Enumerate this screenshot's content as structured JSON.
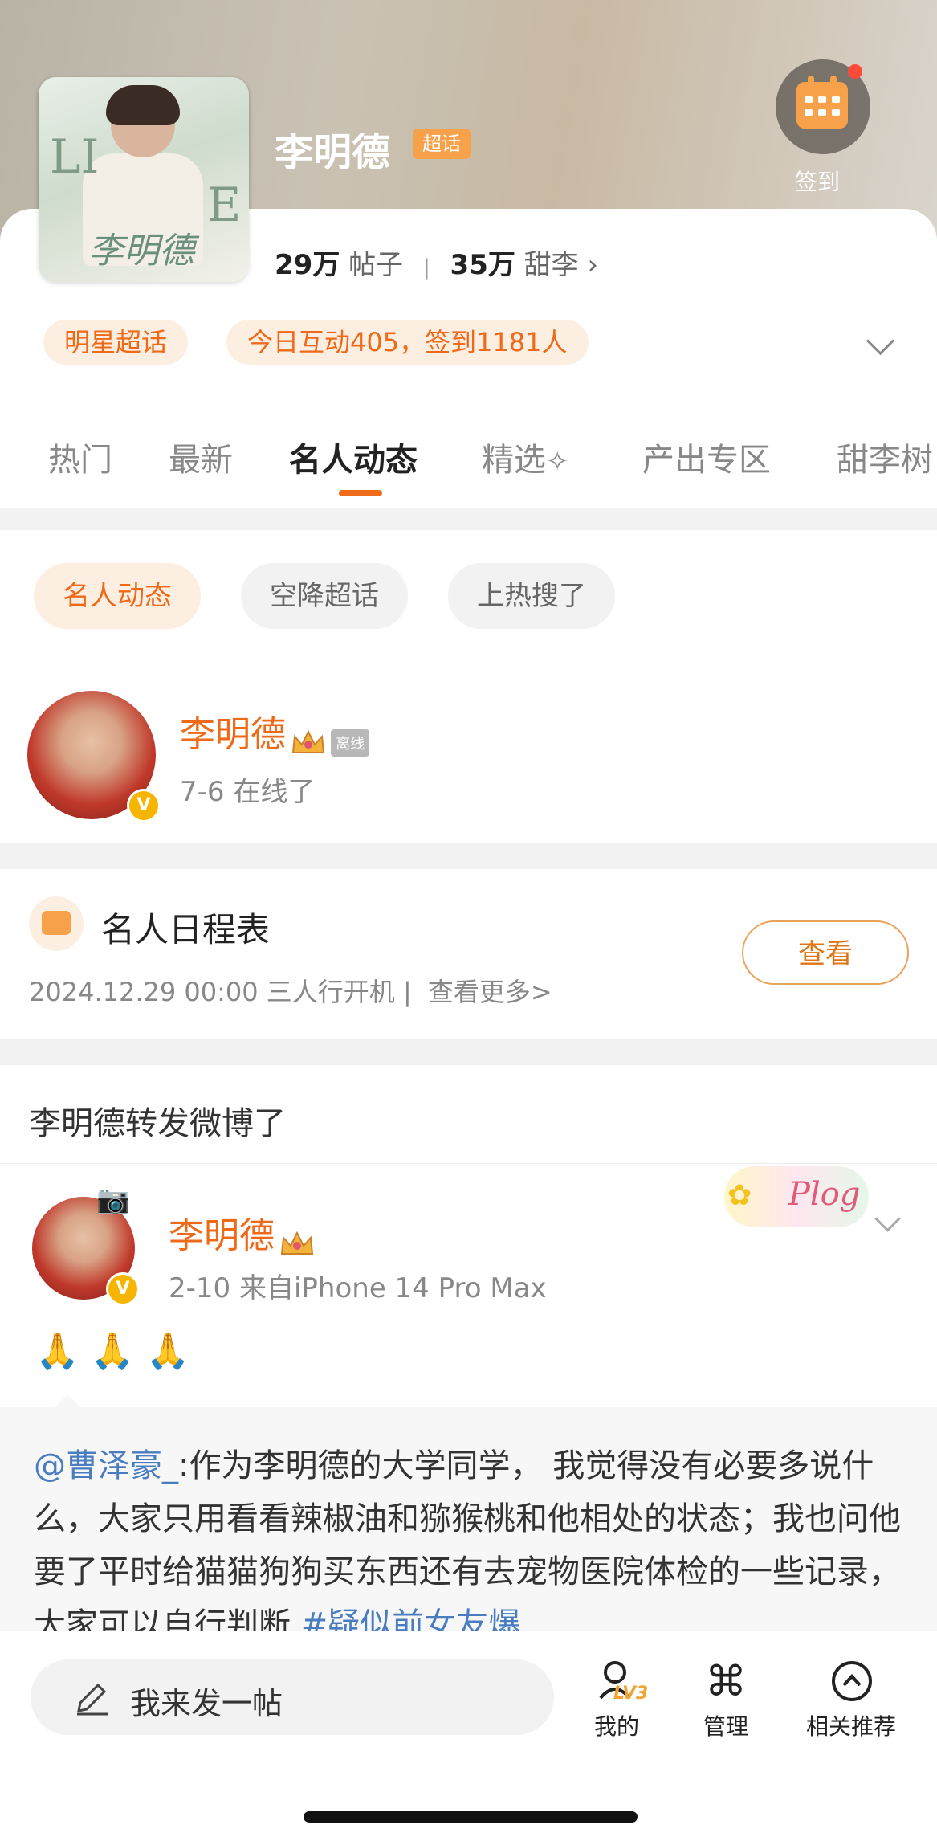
{
  "header": {
    "title": "李明德",
    "badge": "超话",
    "checkin_label": "签到"
  },
  "cover": {
    "letters_left": "LI",
    "letters_right": "E",
    "signature": "李明德"
  },
  "stats": {
    "posts_count": "29万",
    "posts_label": "帖子",
    "fans_count": "35万",
    "fans_label": "甜李"
  },
  "pills": {
    "category": "明星超话",
    "today": "今日互动405，签到1181人"
  },
  "tabs": [
    {
      "label": "热门"
    },
    {
      "label": "最新"
    },
    {
      "label": "名人动态"
    },
    {
      "label": "精选"
    },
    {
      "label": "产出专区"
    },
    {
      "label": "甜李树"
    }
  ],
  "filters": [
    {
      "label": "名人动态"
    },
    {
      "label": "空降超话"
    },
    {
      "label": "上热搜了"
    }
  ],
  "celebrity": {
    "name": "李明德",
    "status_tag": "离线",
    "last_online": "7-6 在线了",
    "verified_mark": "V"
  },
  "schedule": {
    "title": "名人日程表",
    "detail": "2024.12.29 00:00 三人行开机 |",
    "more": "查看更多>",
    "view_button": "查看"
  },
  "repost": {
    "header": "李明德转发微博了",
    "author": "李明德",
    "meta": "2-10  来自iPhone 14 Pro Max",
    "sticker": "Plog",
    "emoji": [
      "🙏",
      "🙏",
      "🙏"
    ]
  },
  "quoted": {
    "mention": "@曹泽豪_",
    "text": ":作为李明德的大学同学， 我觉得没有必要多说什么，大家只用看看辣椒油和猕猴桃和他相处的状态；我也问他要了平时给猫猫狗狗买东西还有去宠物医院体检的一些记录，大家可以自行判断 ",
    "hashtag": "#疑似前女友爆"
  },
  "bottom_bar": {
    "post_placeholder": "我来发一帖",
    "level": "LV3",
    "nav": [
      {
        "label": "我的",
        "icon": "profile-level-icon"
      },
      {
        "label": "管理",
        "icon": "command-icon"
      },
      {
        "label": "相关推荐",
        "icon": "chevron-up-circle-icon"
      }
    ]
  },
  "colors": {
    "accent": "#ef6a18",
    "badge": "#f7a24b",
    "link": "#4a7cc0"
  }
}
